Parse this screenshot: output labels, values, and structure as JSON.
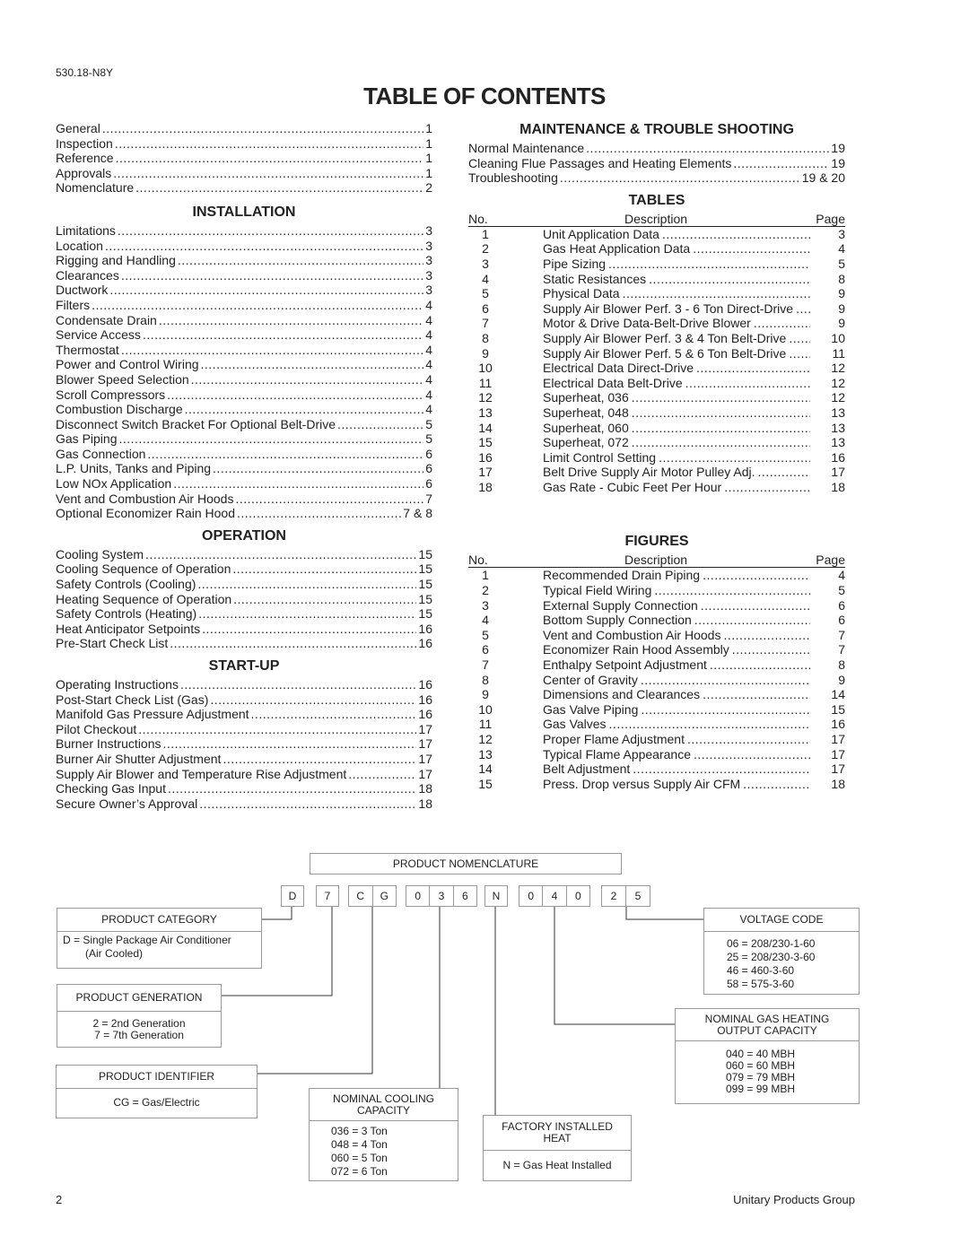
{
  "doc_number": "530.18-N8Y",
  "title": "TABLE OF CONTENTS",
  "left": {
    "general": [
      [
        "General",
        "1"
      ],
      [
        "Inspection",
        "1"
      ],
      [
        "Reference",
        "1"
      ],
      [
        "Approvals",
        "1"
      ],
      [
        "Nomenclature",
        "2"
      ]
    ],
    "installation_heading": "INSTALLATION",
    "installation": [
      [
        "Limitations",
        "3"
      ],
      [
        "Location",
        "3"
      ],
      [
        "Rigging and Handling",
        "3"
      ],
      [
        "Clearances",
        "3"
      ],
      [
        "Ductwork",
        "3"
      ],
      [
        "Filters",
        "4"
      ],
      [
        "Condensate Drain",
        "4"
      ],
      [
        "Service Access",
        "4"
      ],
      [
        "Thermostat",
        "4"
      ],
      [
        "Power and Control Wiring",
        "4"
      ],
      [
        "Blower Speed Selection",
        "4"
      ],
      [
        "Scroll Compressors",
        "4"
      ],
      [
        "Combustion Discharge",
        "4"
      ],
      [
        "Disconnect Switch Bracket For Optional Belt-Drive",
        "5"
      ],
      [
        "Gas Piping",
        "5"
      ],
      [
        "Gas Connection",
        "6"
      ],
      [
        "L.P. Units, Tanks and Piping",
        "6"
      ],
      [
        "Low NOx Application",
        "6"
      ],
      [
        "Vent and Combustion Air Hoods",
        "7"
      ],
      [
        "Optional Economizer Rain Hood",
        "7 & 8"
      ]
    ],
    "operation_heading": "OPERATION",
    "operation": [
      [
        "Cooling System",
        "15"
      ],
      [
        "Cooling Sequence of Operation",
        "15"
      ],
      [
        "Safety Controls (Cooling)",
        "15"
      ],
      [
        "Heating Sequence of Operation",
        "15"
      ],
      [
        "Safety Controls (Heating)",
        "15"
      ],
      [
        "Heat Anticipator Setpoints",
        "16"
      ],
      [
        "Pre-Start Check List",
        "16"
      ]
    ],
    "startup_heading": "START-UP",
    "startup": [
      [
        "Operating Instructions",
        "16"
      ],
      [
        "Post-Start Check List (Gas)",
        "16"
      ],
      [
        "Manifold Gas Pressure Adjustment",
        "16"
      ],
      [
        "Pilot Checkout",
        "17"
      ],
      [
        "Burner Instructions",
        "17"
      ],
      [
        "Burner Air Shutter Adjustment",
        "17"
      ],
      [
        "Supply Air Blower and Temperature Rise Adjustment",
        "17"
      ],
      [
        "Checking Gas Input",
        "18"
      ],
      [
        "Secure Owner’s Approval",
        "18"
      ]
    ]
  },
  "right": {
    "maintenance_heading": "MAINTENANCE & TROUBLE SHOOTING",
    "maintenance": [
      [
        "Normal Maintenance",
        "19"
      ],
      [
        "Cleaning Flue Passages and Heating Elements",
        "19"
      ],
      [
        "Troubleshooting",
        "19 & 20"
      ]
    ],
    "tables_heading": "TABLES",
    "col_no": "No.",
    "col_desc": "Description",
    "col_page": "Page",
    "tables": [
      [
        "1",
        "Unit Application Data",
        "3"
      ],
      [
        "2",
        "Gas Heat Application Data",
        "4"
      ],
      [
        "3",
        "Pipe Sizing",
        "5"
      ],
      [
        "4",
        "Static Resistances",
        "8"
      ],
      [
        "5",
        "Physical Data",
        "9"
      ],
      [
        "6",
        "Supply Air Blower Perf. 3 - 6 Ton Direct-Drive",
        "9"
      ],
      [
        "7",
        "Motor & Drive Data-Belt-Drive Blower",
        "9"
      ],
      [
        "8",
        "Supply Air Blower Perf. 3 & 4 Ton Belt-Drive",
        "10"
      ],
      [
        "9",
        "Supply Air Blower Perf. 5 & 6 Ton  Belt-Drive",
        "11"
      ],
      [
        "10",
        "Electrical Data Direct-Drive",
        "12"
      ],
      [
        "11",
        "Electrical Data Belt-Drive",
        "12"
      ],
      [
        "12",
        "Superheat, 036",
        "12"
      ],
      [
        "13",
        "Superheat, 048",
        "13"
      ],
      [
        "14",
        "Superheat, 060",
        "13"
      ],
      [
        "15",
        "Superheat, 072",
        "13"
      ],
      [
        "16",
        "Limit Control Setting",
        "16"
      ],
      [
        "17",
        "Belt Drive Supply Air Motor Pulley Adj.",
        "17"
      ],
      [
        "18",
        "Gas Rate - Cubic Feet Per Hour",
        "18"
      ]
    ],
    "figures_heading": "FIGURES",
    "figures": [
      [
        "1",
        "Recommended Drain Piping",
        "4"
      ],
      [
        "2",
        "Typical Field Wiring",
        "5"
      ],
      [
        "3",
        "External Supply Connection",
        "6"
      ],
      [
        "4",
        "Bottom Supply Connection",
        "6"
      ],
      [
        "5",
        "Vent and Combustion Air Hoods",
        "7"
      ],
      [
        "6",
        "Economizer Rain Hood Assembly",
        "7"
      ],
      [
        "7",
        "Enthalpy Setpoint Adjustment",
        "8"
      ],
      [
        "8",
        "Center of Gravity",
        "9"
      ],
      [
        "9",
        "Dimensions and Clearances",
        "14"
      ],
      [
        "10",
        "Gas Valve Piping",
        "15"
      ],
      [
        "11",
        "Gas Valves",
        "16"
      ],
      [
        "12",
        "Proper Flame Adjustment",
        "17"
      ],
      [
        "13",
        "Typical Flame Appearance",
        "17"
      ],
      [
        "14",
        "Belt Adjustment",
        "17"
      ],
      [
        "15",
        "Press. Drop versus Supply Air CFM",
        "18"
      ]
    ]
  },
  "nomenclature": {
    "title": "PRODUCT NOMENCLATURE",
    "groups": [
      [
        "D"
      ],
      [
        "7"
      ],
      [
        "C",
        "G"
      ],
      [
        "0",
        "3",
        "6"
      ],
      [
        "N"
      ],
      [
        "0",
        "4",
        "0"
      ],
      [
        "2",
        "5"
      ]
    ],
    "category": {
      "header": "PRODUCT CATEGORY",
      "lines": [
        "D = Single Package Air Conditioner",
        "(Air Cooled)"
      ]
    },
    "generation": {
      "header": "PRODUCT GENERATION",
      "lines": [
        "2 = 2nd Generation",
        "7 = 7th Generation"
      ]
    },
    "identifier": {
      "header": "PRODUCT IDENTIFIER",
      "lines": [
        "CG = Gas/Electric"
      ]
    },
    "cooling": {
      "header": "NOMINAL COOLING CAPACITY",
      "lines": [
        "036 = 3 Ton",
        "048 = 4 Ton",
        "060 = 5 Ton",
        "072 = 6 Ton"
      ]
    },
    "heat": {
      "header": "FACTORY INSTALLED HEAT",
      "lines": [
        "N = Gas Heat Installed"
      ]
    },
    "voltage": {
      "header": "VOLTAGE CODE",
      "lines": [
        "06 = 208/230-1-60",
        "25 = 208/230-3-60",
        "46 = 460-3-60",
        "58 = 575-3-60"
      ]
    },
    "gas_heating": {
      "header": "NOMINAL GAS HEATING OUTPUT CAPACITY",
      "lines": [
        "040 = 40 MBH",
        "060 = 60 MBH",
        "079 = 79 MBH",
        "099 = 99 MBH"
      ]
    }
  },
  "footer": {
    "page": "2",
    "company": "Unitary Products Group"
  }
}
